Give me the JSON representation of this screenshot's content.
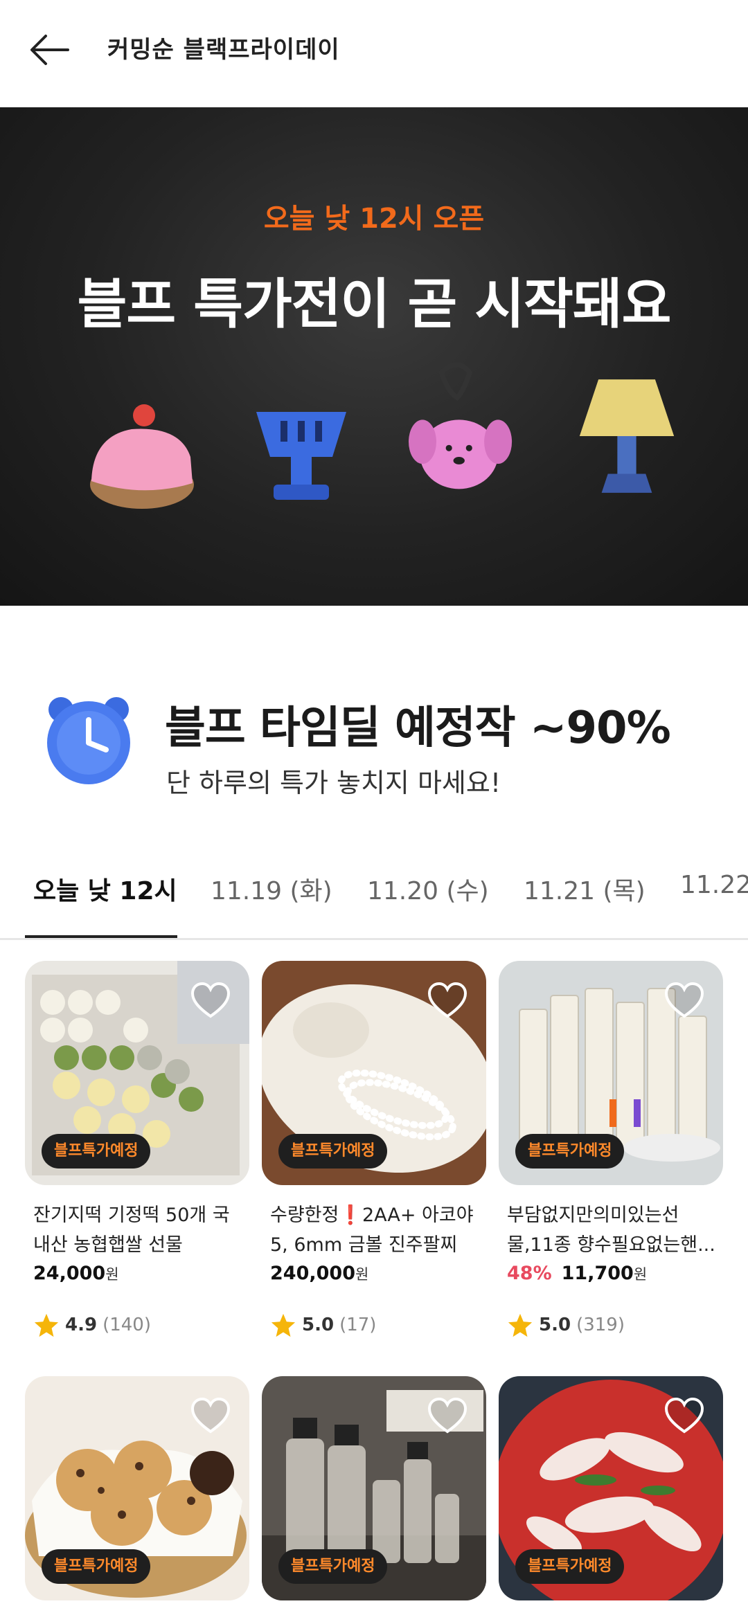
{
  "header": {
    "title": "커밍순 블랙프라이데이"
  },
  "banner": {
    "subtitle": "오늘 낮 12시 오픈",
    "title": "블프 특가전이 곧 시작돼요"
  },
  "deal": {
    "title": "블프 타임딜 예정작 ~90%",
    "description": "단 하루의 특가 놓치지 마세요!"
  },
  "tabs": [
    {
      "label": "오늘 낮 12시",
      "active": true
    },
    {
      "label": "11.19 (화)"
    },
    {
      "label": "11.20 (수)"
    },
    {
      "label": "11.21 (목)"
    },
    {
      "label": "11.22"
    }
  ],
  "colors": {
    "accent": "#f26a1b",
    "discount": "#e84a5f",
    "badge_text": "#ff8a2b"
  },
  "products": [
    {
      "name": "잔기지떡 기정떡 50개 국내산 농협햅쌀 선물",
      "badge": "블프특가예정",
      "discount": "",
      "price": "24,000",
      "currency": "원",
      "rating": "4.9",
      "reviews": "(140)"
    },
    {
      "name": "수량한정❗2AA+ 아코야 5, 6mm 금볼 진주팔찌",
      "badge": "블프특가예정",
      "discount": "",
      "price": "240,000",
      "currency": "원",
      "rating": "5.0",
      "reviews": "(17)"
    },
    {
      "name": "부담없지만의미있는선물,11종 향수필요없는핸...",
      "badge": "블프특가예정",
      "discount": "48%",
      "price": "11,700",
      "currency": "원",
      "rating": "5.0",
      "reviews": "(319)"
    },
    {
      "badge": "블프특가예정"
    },
    {
      "badge": "블프특가예정"
    },
    {
      "badge": "블프특가예정"
    }
  ]
}
